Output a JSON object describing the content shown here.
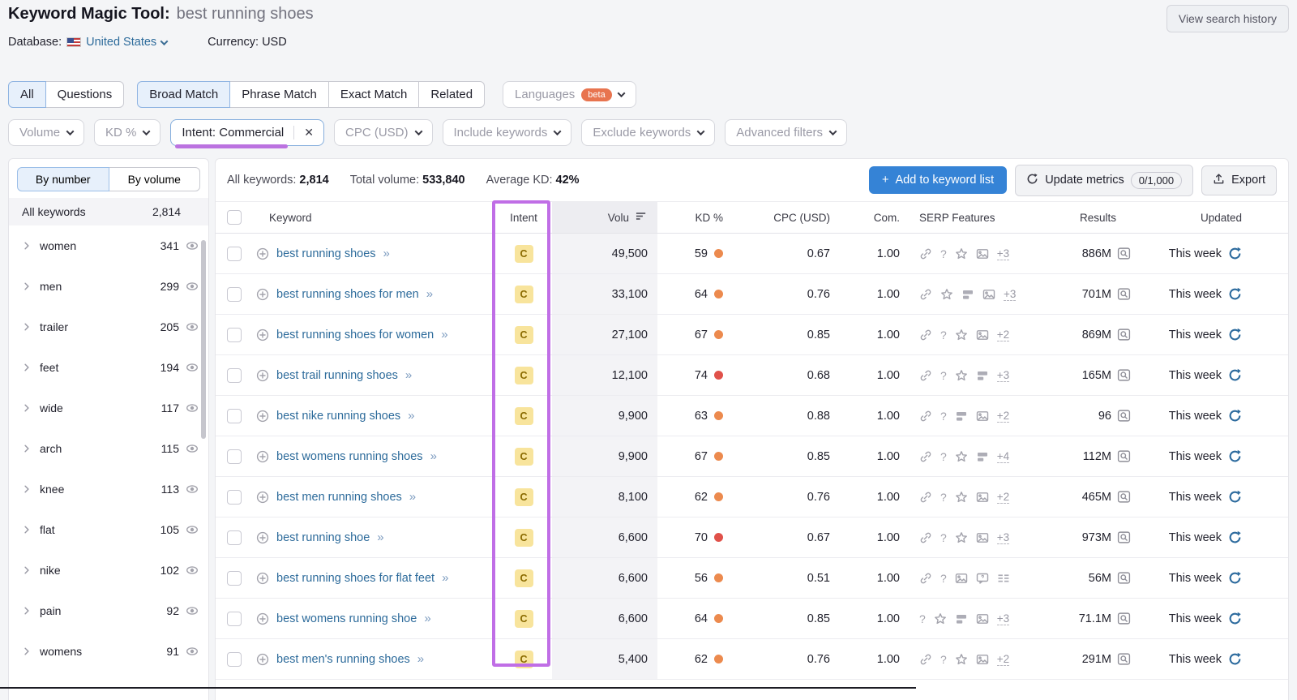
{
  "header": {
    "title": "Keyword Magic Tool:",
    "query": "best running shoes",
    "view_history_label": "View search history",
    "database_label": "Database:",
    "database_value": "United States",
    "currency_label": "Currency:",
    "currency_value": "USD"
  },
  "match_tabs": {
    "group1": [
      {
        "label": "All",
        "active": true
      },
      {
        "label": "Questions",
        "active": false
      }
    ],
    "group2": [
      {
        "label": "Broad Match",
        "active": true
      },
      {
        "label": "Phrase Match",
        "active": false
      },
      {
        "label": "Exact Match",
        "active": false
      },
      {
        "label": "Related",
        "active": false
      }
    ],
    "languages": {
      "label": "Languages",
      "badge": "beta"
    }
  },
  "filters": {
    "before": [
      "Volume",
      "KD %"
    ],
    "intent_chip": {
      "label": "Intent: Commercial",
      "close": "✕",
      "accent_color": "#bb72e0"
    },
    "after": [
      "CPC (USD)",
      "Include keywords",
      "Exclude keywords",
      "Advanced filters"
    ]
  },
  "sidebar": {
    "toggle": [
      {
        "label": "By number",
        "active": true
      },
      {
        "label": "By volume",
        "active": false
      }
    ],
    "all_row": {
      "label": "All keywords",
      "count": "2,814"
    },
    "groups": [
      {
        "label": "women",
        "count": "341"
      },
      {
        "label": "men",
        "count": "299"
      },
      {
        "label": "trailer",
        "count": "205"
      },
      {
        "label": "feet",
        "count": "194"
      },
      {
        "label": "wide",
        "count": "117"
      },
      {
        "label": "arch",
        "count": "115"
      },
      {
        "label": "knee",
        "count": "113"
      },
      {
        "label": "flat",
        "count": "105"
      },
      {
        "label": "nike",
        "count": "102"
      },
      {
        "label": "pain",
        "count": "92"
      },
      {
        "label": "womens",
        "count": "91"
      }
    ]
  },
  "stats": {
    "all_keywords_label": "All keywords:",
    "all_keywords": "2,814",
    "total_volume_label": "Total volume:",
    "total_volume": "533,840",
    "avg_kd_label": "Average KD:",
    "avg_kd": "42%"
  },
  "actions": {
    "add_label": "Add to keyword list",
    "update_label": "Update metrics",
    "update_quota": "0/1,000",
    "export_label": "Export"
  },
  "table": {
    "columns": {
      "keyword": "Keyword",
      "intent": "Intent",
      "volume": "Volu",
      "kd": "KD %",
      "cpc": "CPC (USD)",
      "com": "Com.",
      "serp": "SERP Features",
      "results": "Results",
      "updated": "Updated"
    },
    "accent_colors": {
      "intent_highlight": "#c06ee6",
      "kd_orange": "#ec8a4e",
      "kd_red": "#e0514a",
      "intent_badge_bg": "#f8e49c",
      "link_blue": "#2d6b9b",
      "button_blue": "#3583d6"
    },
    "rows": [
      {
        "keyword": "best running shoes",
        "intent": "C",
        "volume": "49,500",
        "kd": "59",
        "kd_level": "orange",
        "cpc": "0.67",
        "com": "1.00",
        "serp": [
          "link",
          "question",
          "star",
          "image"
        ],
        "serp_more": "+3",
        "results": "886M",
        "updated": "This week"
      },
      {
        "keyword": "best running shoes for men",
        "intent": "C",
        "volume": "33,100",
        "kd": "64",
        "kd_level": "orange",
        "cpc": "0.76",
        "com": "1.00",
        "serp": [
          "link",
          "star",
          "sitelinks",
          "image"
        ],
        "serp_more": "+3",
        "results": "701M",
        "updated": "This week"
      },
      {
        "keyword": "best running shoes for women",
        "intent": "C",
        "volume": "27,100",
        "kd": "67",
        "kd_level": "orange",
        "cpc": "0.85",
        "com": "1.00",
        "serp": [
          "link",
          "question",
          "star",
          "image"
        ],
        "serp_more": "+2",
        "results": "869M",
        "updated": "This week"
      },
      {
        "keyword": "best trail running shoes",
        "intent": "C",
        "volume": "12,100",
        "kd": "74",
        "kd_level": "red",
        "cpc": "0.68",
        "com": "1.00",
        "serp": [
          "link",
          "question",
          "star",
          "sitelinks"
        ],
        "serp_more": "+3",
        "results": "165M",
        "updated": "This week"
      },
      {
        "keyword": "best nike running shoes",
        "intent": "C",
        "volume": "9,900",
        "kd": "63",
        "kd_level": "orange",
        "cpc": "0.88",
        "com": "1.00",
        "serp": [
          "link",
          "question",
          "sitelinks",
          "image"
        ],
        "serp_more": "+2",
        "results": "96",
        "updated": "This week"
      },
      {
        "keyword": "best womens running shoes",
        "intent": "C",
        "volume": "9,900",
        "kd": "67",
        "kd_level": "orange",
        "cpc": "0.85",
        "com": "1.00",
        "serp": [
          "link",
          "question",
          "star",
          "sitelinks"
        ],
        "serp_more": "+4",
        "results": "112M",
        "updated": "This week"
      },
      {
        "keyword": "best men running shoes",
        "intent": "C",
        "volume": "8,100",
        "kd": "62",
        "kd_level": "orange",
        "cpc": "0.76",
        "com": "1.00",
        "serp": [
          "link",
          "question",
          "star",
          "image"
        ],
        "serp_more": "+2",
        "results": "465M",
        "updated": "This week"
      },
      {
        "keyword": "best running shoe",
        "intent": "C",
        "volume": "6,600",
        "kd": "70",
        "kd_level": "red",
        "cpc": "0.67",
        "com": "1.00",
        "serp": [
          "link",
          "question",
          "star",
          "image"
        ],
        "serp_more": "+3",
        "results": "973M",
        "updated": "This week"
      },
      {
        "keyword": "best running shoes for flat feet",
        "intent": "C",
        "volume": "6,600",
        "kd": "56",
        "kd_level": "orange",
        "cpc": "0.51",
        "com": "1.00",
        "serp": [
          "link",
          "question",
          "image",
          "review",
          "list"
        ],
        "serp_more": null,
        "results": "56M",
        "updated": "This week"
      },
      {
        "keyword": "best womens running shoe",
        "intent": "C",
        "volume": "6,600",
        "kd": "64",
        "kd_level": "orange",
        "cpc": "0.85",
        "com": "1.00",
        "serp": [
          "question",
          "star",
          "sitelinks",
          "image"
        ],
        "serp_more": "+3",
        "results": "71.1M",
        "updated": "This week"
      },
      {
        "keyword": "best men's running shoes",
        "intent": "C",
        "volume": "5,400",
        "kd": "62",
        "kd_level": "orange",
        "cpc": "0.76",
        "com": "1.00",
        "serp": [
          "link",
          "question",
          "star",
          "image"
        ],
        "serp_more": "+2",
        "results": "291M",
        "updated": "This week"
      }
    ]
  }
}
